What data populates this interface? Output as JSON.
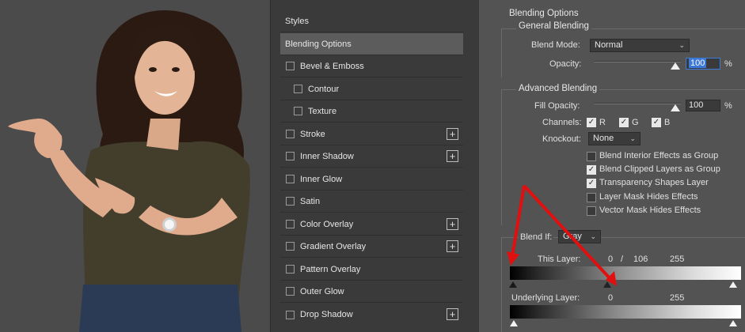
{
  "styles_panel": {
    "items": [
      {
        "label": "Styles",
        "checkbox": false,
        "plus": false,
        "kind": "header"
      },
      {
        "label": "Blending Options",
        "checkbox": false,
        "plus": false,
        "kind": "selected"
      },
      {
        "label": "Bevel & Emboss",
        "checkbox": true,
        "plus": false,
        "kind": "normal"
      },
      {
        "label": "Contour",
        "checkbox": true,
        "plus": false,
        "kind": "indent"
      },
      {
        "label": "Texture",
        "checkbox": true,
        "plus": false,
        "kind": "indent"
      },
      {
        "label": "Stroke",
        "checkbox": true,
        "plus": true,
        "kind": "normal"
      },
      {
        "label": "Inner Shadow",
        "checkbox": true,
        "plus": true,
        "kind": "normal"
      },
      {
        "label": "Inner Glow",
        "checkbox": true,
        "plus": false,
        "kind": "normal"
      },
      {
        "label": "Satin",
        "checkbox": true,
        "plus": false,
        "kind": "normal"
      },
      {
        "label": "Color Overlay",
        "checkbox": true,
        "plus": true,
        "kind": "normal"
      },
      {
        "label": "Gradient Overlay",
        "checkbox": true,
        "plus": true,
        "kind": "normal"
      },
      {
        "label": "Pattern Overlay",
        "checkbox": true,
        "plus": false,
        "kind": "normal"
      },
      {
        "label": "Outer Glow",
        "checkbox": true,
        "plus": false,
        "kind": "normal"
      },
      {
        "label": "Drop Shadow",
        "checkbox": true,
        "plus": true,
        "kind": "normal"
      }
    ],
    "plus_symbol": "+"
  },
  "blending_options": {
    "title": "Blending Options",
    "general": {
      "title": "General Blending",
      "blend_mode_label": "Blend Mode:",
      "blend_mode_value": "Normal",
      "opacity_label": "Opacity:",
      "opacity_value": "100",
      "percent": "%"
    },
    "advanced": {
      "title": "Advanced Blending",
      "fill_opacity_label": "Fill Opacity:",
      "fill_opacity_value": "100",
      "percent": "%",
      "channels_label": "Channels:",
      "channels": [
        {
          "label": "R",
          "checked": true
        },
        {
          "label": "G",
          "checked": true
        },
        {
          "label": "B",
          "checked": true
        }
      ],
      "knockout_label": "Knockout:",
      "knockout_value": "None",
      "options": [
        {
          "label": "Blend Interior Effects as Group",
          "checked": false
        },
        {
          "label": "Blend Clipped Layers as Group",
          "checked": true
        },
        {
          "label": "Transparency Shapes Layer",
          "checked": true
        },
        {
          "label": "Layer Mask Hides Effects",
          "checked": false
        },
        {
          "label": "Vector Mask Hides Effects",
          "checked": false
        }
      ]
    },
    "blend_if": {
      "label": "Blend If:",
      "value": "Gray",
      "this_layer_label": "This Layer:",
      "this_layer_low": "0",
      "this_layer_sep": "/",
      "this_layer_split": "106",
      "this_layer_high": "255",
      "underlying_label": "Underlying Layer:",
      "underlying_low": "0",
      "underlying_high": "255"
    }
  },
  "colors": {
    "annotation_arrow": "#e01010",
    "selection_blue": "#3b78d7"
  }
}
